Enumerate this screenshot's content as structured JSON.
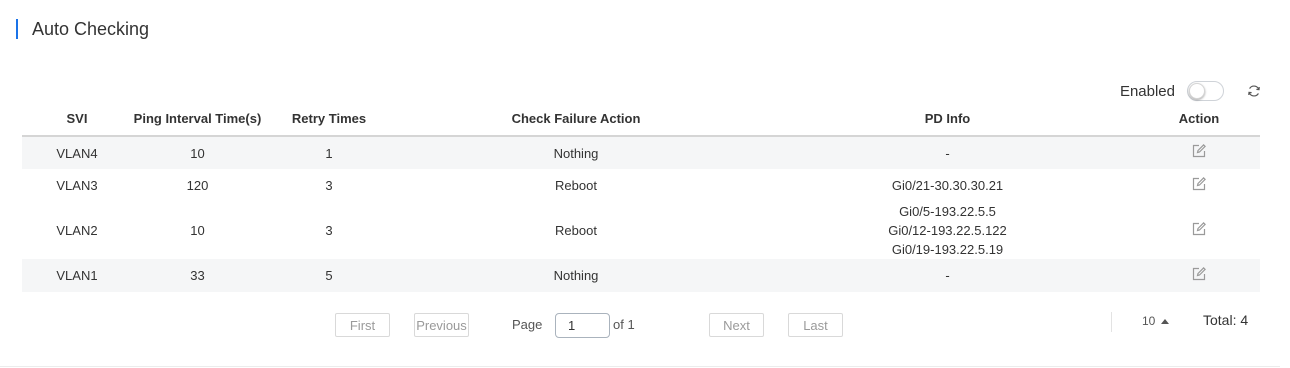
{
  "section": {
    "title": "Auto Checking"
  },
  "toolbar": {
    "enabled_label": "Enabled",
    "enabled_state": false,
    "refresh_icon": "refresh-icon"
  },
  "table": {
    "headers": {
      "svi": "SVI",
      "ping_interval": "Ping Interval Time(s)",
      "retry": "Retry Times",
      "failure_action": "Check Failure Action",
      "pd_info": "PD Info",
      "action": "Action"
    },
    "rows": [
      {
        "svi": "VLAN4",
        "ping_interval": "10",
        "retry": "1",
        "failure_action": "Nothing",
        "pd_info": [
          "-"
        ]
      },
      {
        "svi": "VLAN3",
        "ping_interval": "120",
        "retry": "3",
        "failure_action": "Reboot",
        "pd_info": [
          "Gi0/21-30.30.30.21"
        ]
      },
      {
        "svi": "VLAN2",
        "ping_interval": "10",
        "retry": "3",
        "failure_action": "Reboot",
        "pd_info": [
          "Gi0/5-193.22.5.5",
          "Gi0/12-193.22.5.122",
          "Gi0/19-193.22.5.19"
        ]
      },
      {
        "svi": "VLAN1",
        "ping_interval": "33",
        "retry": "5",
        "failure_action": "Nothing",
        "pd_info": [
          "-"
        ]
      }
    ],
    "edit_icon": "edit-icon"
  },
  "pagination": {
    "first": "First",
    "previous": "Previous",
    "page_label": "Page",
    "page_value": "1",
    "of_label": "of 1",
    "next": "Next",
    "last": "Last",
    "page_size": "10",
    "total": "Total: 4"
  },
  "colors": {
    "accent": "#1a73e8",
    "row_stripe": "#f5f6f7"
  }
}
